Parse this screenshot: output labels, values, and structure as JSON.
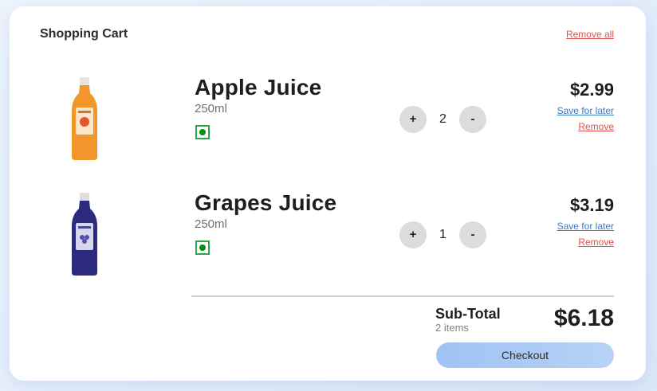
{
  "header": {
    "title": "Shopping Cart",
    "remove_all_label": "Remove all"
  },
  "items": [
    {
      "name": "Apple Juice",
      "size": "250ml",
      "quantity": "2",
      "price": "$2.99",
      "save_label": "Save for later",
      "remove_label": "Remove",
      "plus_label": "+",
      "minus_label": "-",
      "bottle_color": "#f2952a",
      "cap_color": "#e9e4dc"
    },
    {
      "name": "Grapes Juice",
      "size": "250ml",
      "quantity": "1",
      "price": "$3.19",
      "save_label": "Save for later",
      "remove_label": "Remove",
      "plus_label": "+",
      "minus_label": "-",
      "bottle_color": "#2b2a7e",
      "cap_color": "#dedede"
    }
  ],
  "summary": {
    "subtotal_label": "Sub-Total",
    "items_count": "2 items",
    "subtotal_value": "$6.18",
    "checkout_label": "Checkout"
  },
  "colors": {
    "accent_red": "#e0524f",
    "link_blue": "#3a78c4",
    "veg_green": "#0a8f08",
    "checkout_blue": "#9ec3f3"
  }
}
